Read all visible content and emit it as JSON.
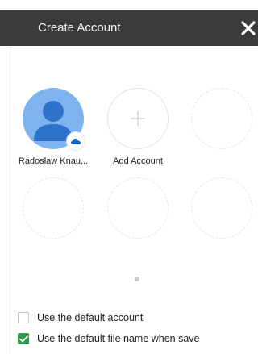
{
  "header": {
    "title": "Create Account"
  },
  "accounts": [
    {
      "name": "Radosław  Knau..."
    }
  ],
  "add_account_label": "Add Account",
  "options": [
    {
      "label": "Use the default account",
      "checked": false
    },
    {
      "label": "Use the default file name when save",
      "checked": true
    }
  ],
  "colors": {
    "header_bg": "#3b3b3b",
    "avatar_bg": "#7fb3f0",
    "avatar_figure": "#2e73c9",
    "check_green": "#2e9b51"
  },
  "icons": {
    "close": "close-icon",
    "add": "plus-icon",
    "cloud": "cloud-icon"
  }
}
